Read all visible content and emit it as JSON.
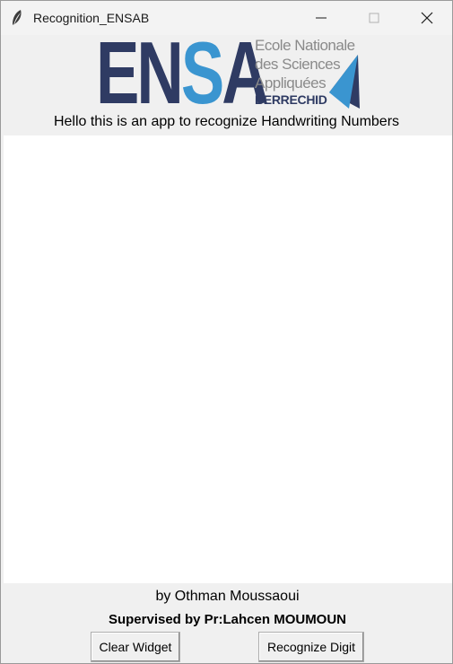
{
  "window": {
    "title": "Recognition_ENSAB",
    "icon": "feather-icon"
  },
  "logo": {
    "part1": "EN",
    "part2": "S",
    "part3": "A",
    "line1": "Ecole Nationale",
    "line2": "des Sciences",
    "line3": "Appliquées",
    "city": "BERRECHID",
    "colors": {
      "dark": "#2f3b63",
      "blue": "#3a95d0",
      "gray": "#8a8a8a"
    }
  },
  "header": {
    "subtitle": "Hello this is an app to recognize Handwriting Numbers"
  },
  "footer": {
    "author": "by Othman Moussaoui",
    "supervisor": "Supervised by Pr:Lahcen MOUMOUN"
  },
  "buttons": {
    "clear": "Clear Widget",
    "recognize": "Recognize Digit"
  }
}
